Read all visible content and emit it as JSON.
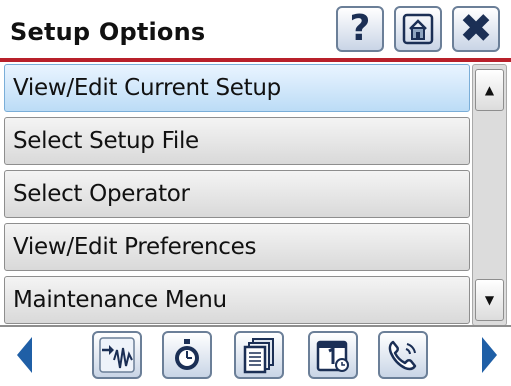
{
  "header": {
    "title": "Setup Options",
    "help_icon": "question-mark-icon",
    "home_icon": "home-icon",
    "close_icon": "close-icon"
  },
  "menu": {
    "items": [
      {
        "label": "View/Edit Current Setup",
        "selected": true
      },
      {
        "label": "Select Setup File",
        "selected": false
      },
      {
        "label": "Select Operator",
        "selected": false
      },
      {
        "label": "View/Edit Preferences",
        "selected": false
      },
      {
        "label": "Maintenance Menu",
        "selected": false
      }
    ]
  },
  "scrollbar": {
    "up_icon": "scroll-up-arrow-icon",
    "down_icon": "scroll-down-arrow-icon"
  },
  "toolbar": {
    "prev_icon": "left-arrow-icon",
    "next_icon": "right-arrow-icon",
    "buttons": [
      {
        "icon": "waveform-arrow-icon"
      },
      {
        "icon": "stopwatch-icon"
      },
      {
        "icon": "documents-icon"
      },
      {
        "icon": "calendar-1-icon"
      },
      {
        "icon": "phone-icon"
      }
    ]
  },
  "colors": {
    "accent_red": "#b8202a",
    "icon_navy": "#1b2f55",
    "nav_blue": "#1f5fa6",
    "selected_bg": "#bcdcf6"
  }
}
